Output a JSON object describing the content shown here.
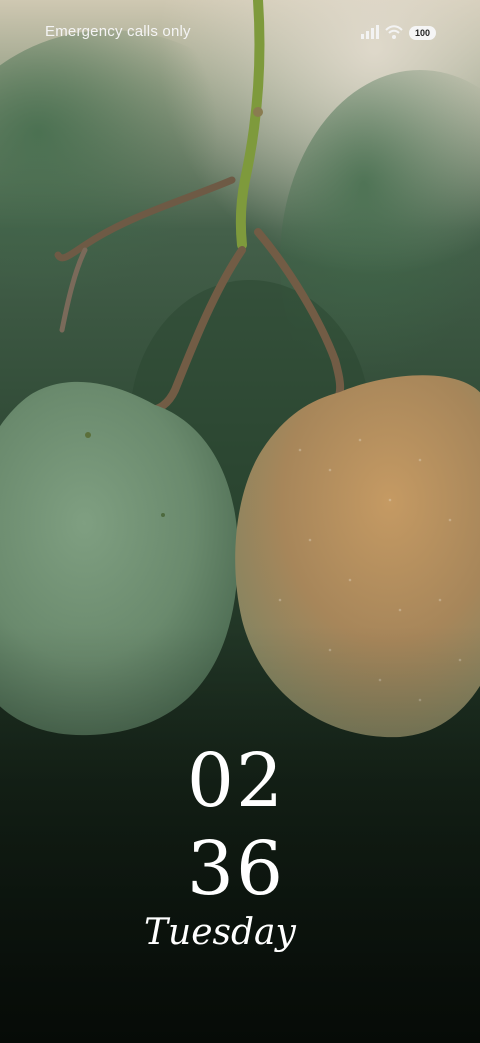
{
  "status_bar": {
    "carrier_text": "Emergency calls only",
    "signal_icon": "signal-bars-icon",
    "wifi_icon": "wifi-icon",
    "battery_level": "100"
  },
  "lock_screen": {
    "hour": "02",
    "minute": "36",
    "day": "Tuesday"
  },
  "wallpaper": {
    "subject": "two-mangoes-on-branch",
    "colors": {
      "left_mango": "#6f8f72",
      "right_mango": "#b08a5a",
      "background": "#1b2a1d",
      "stem": "#7e9a3c"
    }
  }
}
